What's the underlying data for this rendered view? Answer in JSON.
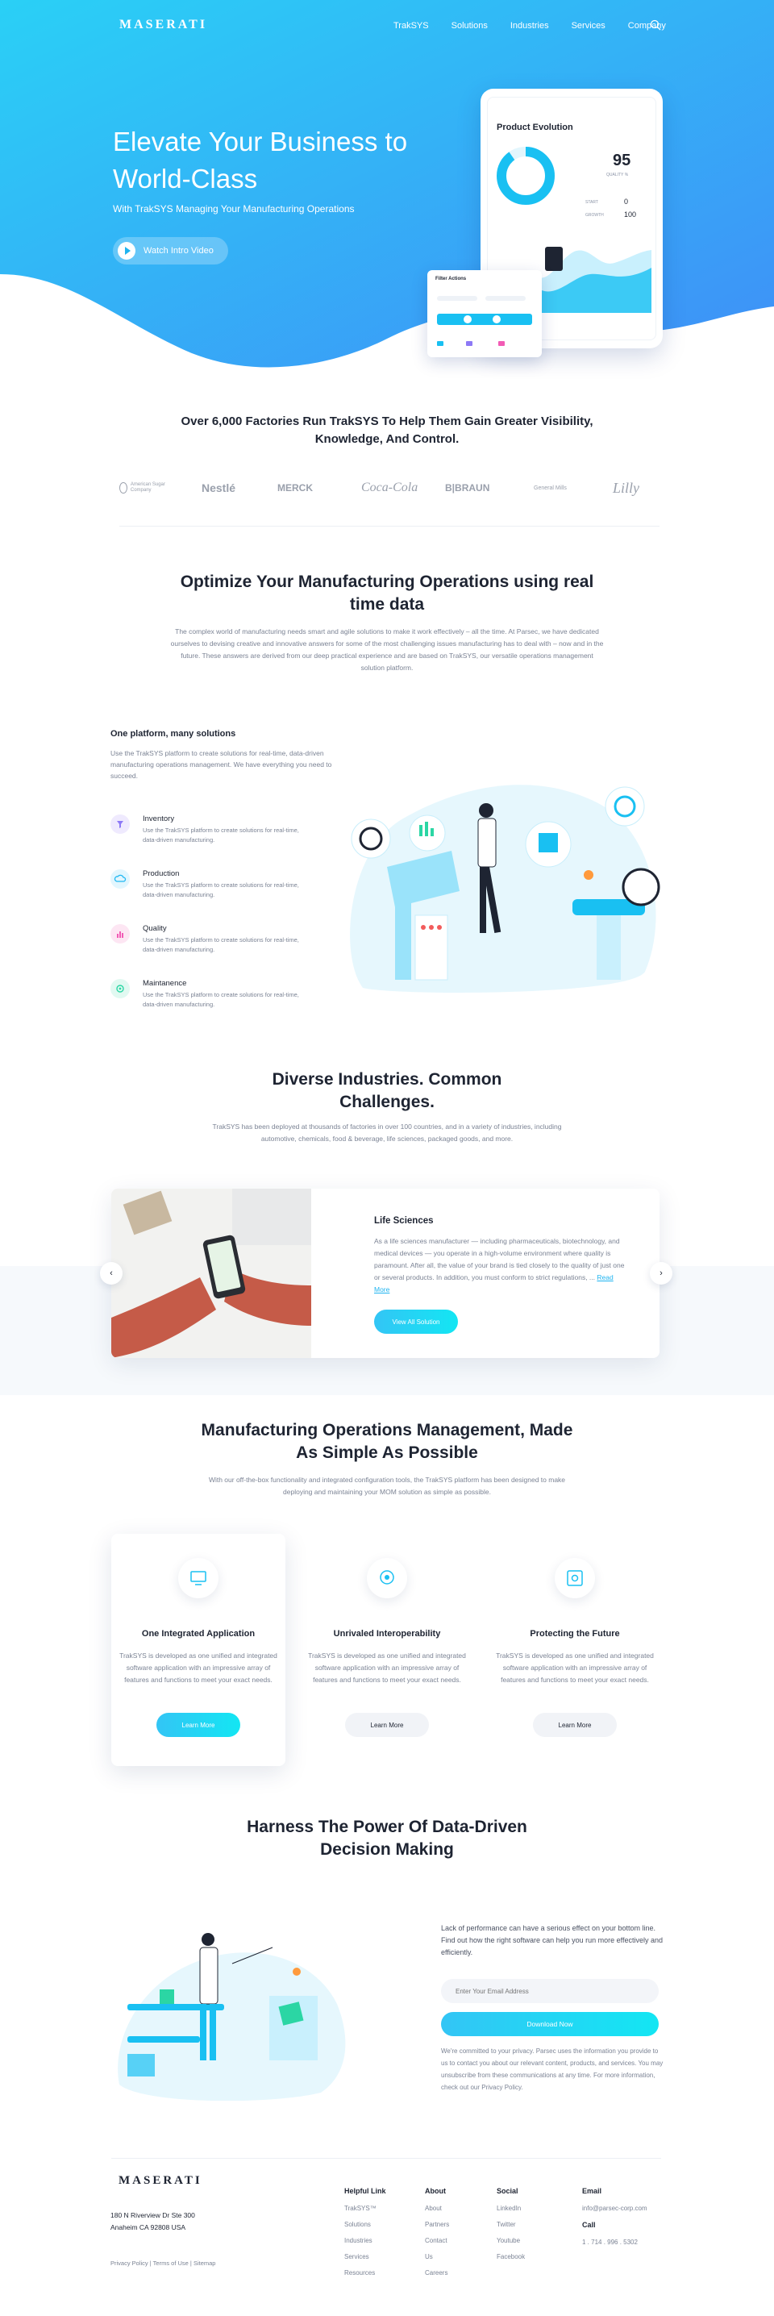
{
  "nav": {
    "logo": "MASERATI",
    "links": [
      "TrakSYS",
      "Solutions",
      "Industries",
      "Services",
      "Company"
    ]
  },
  "hero": {
    "title": "Elevate Your Business to World-Class",
    "subtitle": "With TrakSYS Managing Your Manufacturing Operations",
    "cta": "Watch Intro Video",
    "dashboard": {
      "title": "Product Evolution",
      "score": "95",
      "score_label": "QUALITY %",
      "rows": [
        {
          "label": "START",
          "value": "0"
        },
        {
          "label": "GROWTH",
          "value": "100"
        }
      ],
      "filter_title": "Filter Actions",
      "colors": {
        "accent": "#19c0f2",
        "gradient_start": "#30d0f7",
        "gradient_end": "#3aa0f8"
      }
    }
  },
  "trust": {
    "title": "Over 6,000 Factories Run TrakSYS To Help Them Gain Greater Visibility, Knowledge, And Control.",
    "logos": [
      "American Sugar Company",
      "Nestlé",
      "MERCK",
      "Coca-Cola",
      "B|BRAUN",
      "General Mills",
      "Lilly"
    ]
  },
  "optimize": {
    "title": "Optimize Your Manufacturing Operations using real time data",
    "body": "The complex world of manufacturing needs smart and agile solutions to make it work effectively – all the time. At Parsec, we have dedicated ourselves to devising creative and innovative answers for some of the most challenging issues manufacturing has to deal with – now and in the future. These answers are derived from our deep practical experience and are based on TrakSYS, our versatile operations management solution platform."
  },
  "platform": {
    "title": "One platform, many solutions",
    "body": "Use the TrakSYS platform to create solutions for real-time, data-driven manufacturing operations management. We have everything you need to succeed.",
    "solutions": [
      {
        "name": "Inventory",
        "desc": "Use the TrakSYS platform to create solutions for real-time, data-driven manufacturing.",
        "icon": "filter-icon",
        "color": "#8d79f6"
      },
      {
        "name": "Production",
        "desc": "Use the TrakSYS platform to create solutions for real-time, data-driven manufacturing.",
        "icon": "cloud-icon",
        "color": "#21b8f2"
      },
      {
        "name": "Quality",
        "desc": "Use the TrakSYS platform to create solutions for real-time, data-driven manufacturing.",
        "icon": "chart-icon",
        "color": "#f25bb5"
      },
      {
        "name": "Maintanence",
        "desc": "Use the TrakSYS platform to create solutions for real-time, data-driven manufacturing.",
        "icon": "wrench-icon",
        "color": "#2bd6a4"
      }
    ]
  },
  "industries": {
    "title": "Diverse Industries. Common Challenges.",
    "body": "TrakSYS has been deployed at thousands of factories in over 100 countries, and in a variety of industries, including automotive, chemicals, food & beverage, life sciences, packaged goods, and more.",
    "card_title": "Life Sciences",
    "card_text": "As a life sciences manufacturer — including pharmaceuticals, biotechnology, and medical devices — you operate in a high-volume environment where quality is paramount. After all, the value of your brand is tied closely to the quality of just one or several products. In addition, you must conform to strict regulations, ...",
    "read_more": "Read More",
    "button": "View All Solution"
  },
  "mom": {
    "title": "Manufacturing Operations Management, Made As Simple As Possible",
    "body": "With our off-the-box functionality and integrated configuration tools, the TrakSYS platform has been designed to make deploying and maintaining your MOM solution as simple as possible.",
    "features": [
      {
        "name": "One Integrated Application",
        "text": "TrakSYS is developed as one unified and integrated software application with an impressive array of features and functions to meet your exact needs.",
        "button": "Learn More"
      },
      {
        "name": "Unrivaled Interoperability",
        "text": "TrakSYS is developed as one unified and integrated software application with an impressive array of features and functions to meet your exact needs.",
        "button": "Learn More"
      },
      {
        "name": "Protecting the Future",
        "text": "TrakSYS is developed as one unified and integrated software application with an impressive array of features and functions to meet your exact needs.",
        "button": "Learn More"
      }
    ]
  },
  "harness": {
    "title": "Harness The Power Of Data-Driven Decision Making",
    "text": "Lack of performance can have a serious effect on your bottom line. Find out how the right software can help you run more effectively and efficiently.",
    "email_placeholder": "Enter Your Email Address",
    "button": "Download Now",
    "privacy": "We're committed to your privacy. Parsec uses the information you provide to us to contact you about our relevant content, products, and services. You may unsubscribe from these communications at any time. For more information, check out our Privacy Policy."
  },
  "footer": {
    "logo": "MASERATI",
    "address_line1": "180 N Riverview Dr Ste 300",
    "address_line2": "Anaheim CA 92808 USA",
    "policy": "Privacy Policy | Terms of Use | Sitemap",
    "columns": [
      {
        "title": "Helpful Link",
        "links": [
          "TrakSYS™",
          "Solutions",
          "Industries",
          "Services",
          "Resources"
        ]
      },
      {
        "title": "About",
        "links": [
          "About",
          "Partners",
          "Contact",
          "Us",
          "Careers"
        ]
      },
      {
        "title": "Social",
        "links": [
          "LinkedIn",
          "Twitter",
          "Youtube",
          "Facebook"
        ]
      }
    ],
    "email_title": "Email",
    "email": "info@parsec-corp.com",
    "call_title": "Call",
    "phone": "1 . 714 . 996 . 5302"
  }
}
